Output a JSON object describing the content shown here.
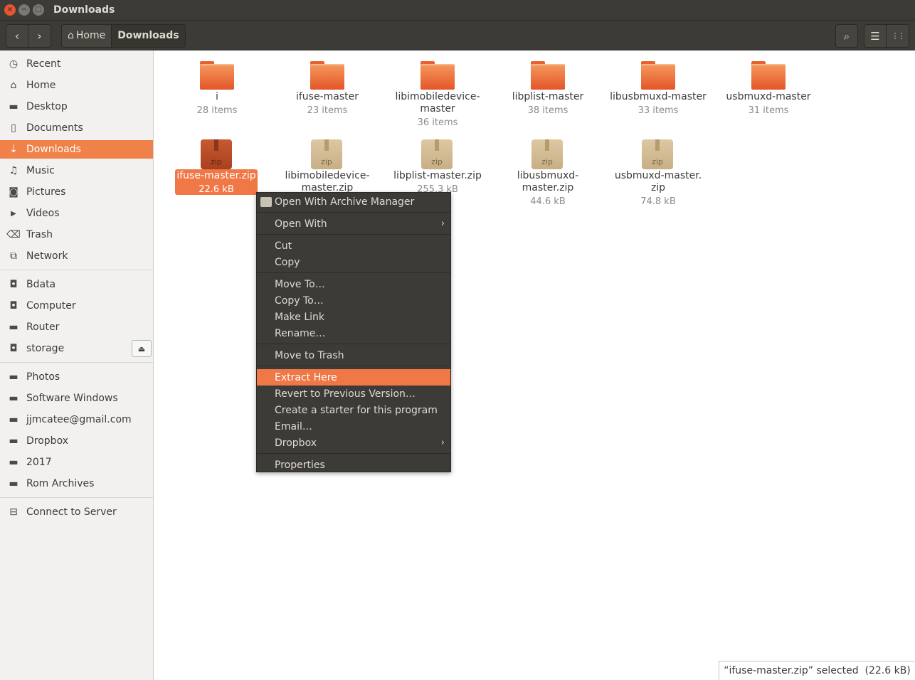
{
  "window": {
    "title": "Downloads",
    "close_glyph": "×",
    "min_glyph": "−",
    "max_glyph": "□"
  },
  "header": {
    "back_icon": "‹",
    "forward_icon": "›",
    "path_home_icon": "⌂",
    "path_home": "Home",
    "path_current": "Downloads",
    "search_icon": "⌕",
    "list_icon": "☰",
    "grid_icon": "⋮⋮"
  },
  "sidebar": {
    "places": [
      {
        "label": "Recent",
        "icon": "◷"
      },
      {
        "label": "Home",
        "icon": "⌂"
      },
      {
        "label": "Desktop",
        "icon": "▬"
      },
      {
        "label": "Documents",
        "icon": "▯"
      },
      {
        "label": "Downloads",
        "icon": "⇣"
      },
      {
        "label": "Music",
        "icon": "♫"
      },
      {
        "label": "Pictures",
        "icon": "◙"
      },
      {
        "label": "Videos",
        "icon": "▶"
      },
      {
        "label": "Trash",
        "icon": "⌫"
      },
      {
        "label": "Network",
        "icon": "⧉"
      }
    ],
    "devices": [
      {
        "label": "Bdata",
        "icon": "◘"
      },
      {
        "label": "Computer",
        "icon": "◘"
      },
      {
        "label": "Router",
        "icon": "▬"
      },
      {
        "label": "storage",
        "icon": "◘"
      }
    ],
    "eject_icon": "⏏",
    "bookmarks": [
      {
        "label": "Photos",
        "icon": "▬"
      },
      {
        "label": "Software Windows",
        "icon": "▬"
      },
      {
        "label": "jjmcatee@gmail.com",
        "icon": "▬"
      },
      {
        "label": "Dropbox",
        "icon": "▬"
      },
      {
        "label": "2017",
        "icon": "▬"
      },
      {
        "label": "Rom Archives",
        "icon": "▬"
      }
    ],
    "connect": {
      "label": "Connect to Server",
      "icon": "⊟"
    }
  },
  "files": {
    "folders": [
      {
        "name": "i",
        "meta": "28 items"
      },
      {
        "name": "ifuse-master",
        "meta": "23 items"
      },
      {
        "name1": "libimobiledevice-",
        "name2": "master",
        "meta": "36 items"
      },
      {
        "name": "libplist-master",
        "meta": "38 items"
      },
      {
        "name": "libusbmuxd-master",
        "meta": "33 items"
      },
      {
        "name": "usbmuxd-master",
        "meta": "31 items"
      }
    ],
    "zips": [
      {
        "name": "ifuse-master.zip",
        "meta": "22.6 kB",
        "icon_label": "zip"
      },
      {
        "name1": "libimobiledevice-",
        "name2": "master.zip",
        "icon_label": "zip"
      },
      {
        "name": "libplist-master.zip",
        "meta": "255.3 kB",
        "icon_label": "zip"
      },
      {
        "name1": "libusbmuxd-",
        "name2": "master.zip",
        "meta": "44.6 kB",
        "icon_label": "zip"
      },
      {
        "name1": "usbmuxd-master.",
        "name2": "zip",
        "meta": "74.8 kB",
        "icon_label": "zip"
      }
    ]
  },
  "context_menu": {
    "items": [
      {
        "label": "Open With Archive Manager"
      },
      {
        "label": "Open With",
        "arrow": "›"
      },
      {
        "label": "Cut"
      },
      {
        "label": "Copy"
      },
      {
        "label": "Move To…"
      },
      {
        "label": "Copy To…"
      },
      {
        "label": "Make Link"
      },
      {
        "label": "Rename…"
      },
      {
        "label": "Move to Trash"
      },
      {
        "label": "Extract Here"
      },
      {
        "label": "Revert to Previous Version…"
      },
      {
        "label": "Create a starter for this program"
      },
      {
        "label": "Email…"
      },
      {
        "label": "Dropbox",
        "arrow": "›"
      },
      {
        "label": "Properties"
      }
    ]
  },
  "status": {
    "text": "“ifuse-master.zip” selected  (22.6 kB)"
  },
  "colors": {
    "accent": "#f07746",
    "chrome": "#3c3b37",
    "sidebar_bg": "#f2f1f0"
  }
}
